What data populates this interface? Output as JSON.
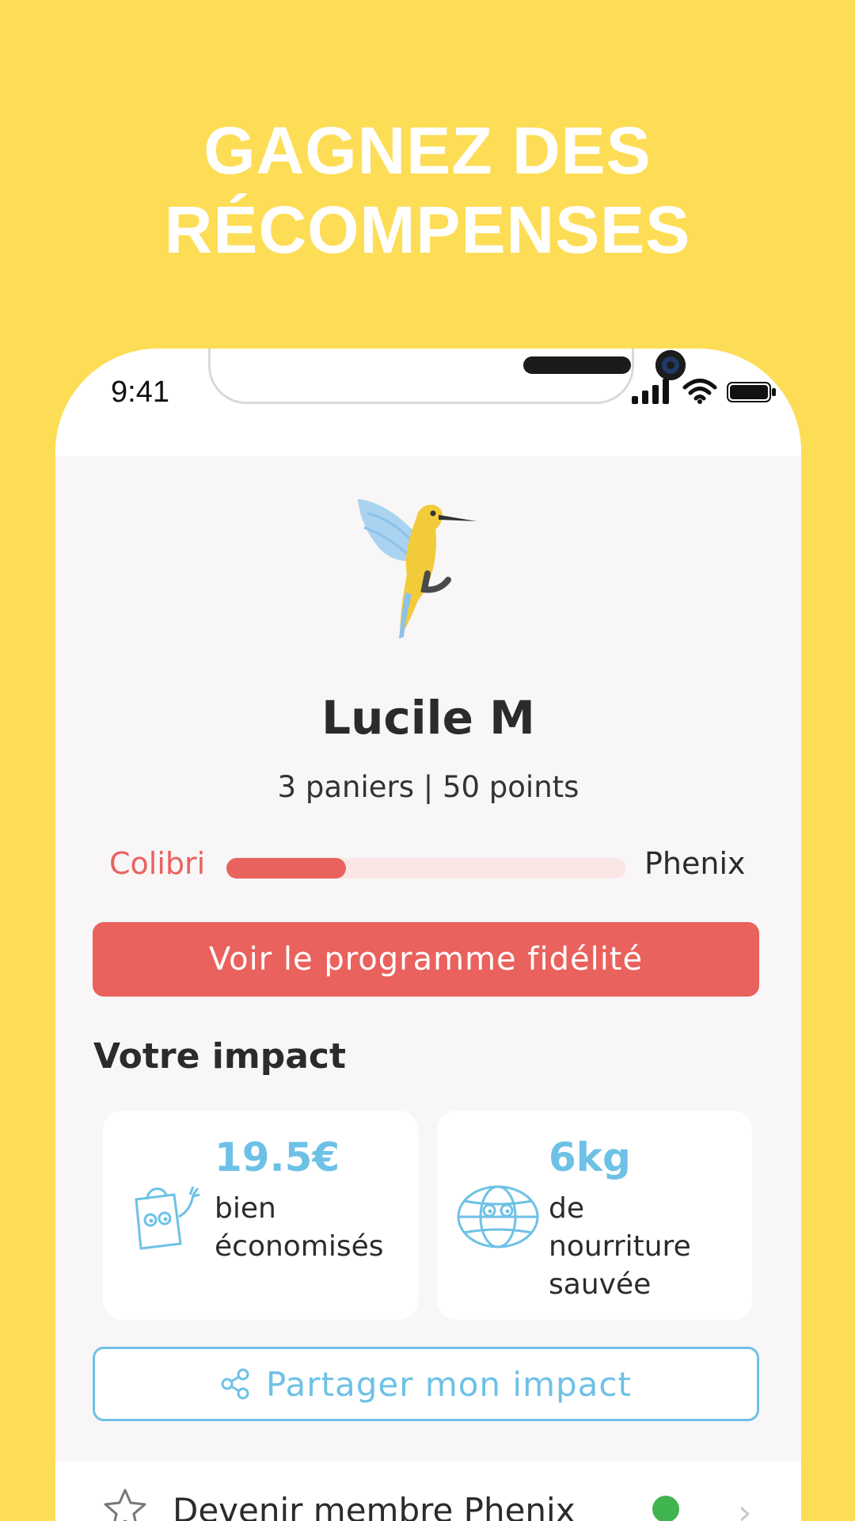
{
  "headline": {
    "line1": "GAGNEZ DES",
    "line2": "RÉCOMPENSES"
  },
  "status_bar": {
    "time": "9:41",
    "icons": [
      "signal-icon",
      "wifi-icon",
      "battery-icon"
    ]
  },
  "profile": {
    "avatar": "hummingbird-icon",
    "name": "Lucile M",
    "stats": "3 paniers | 50 points"
  },
  "level": {
    "current": "Colibri",
    "next": "Phenix",
    "progress_fraction": 0.3
  },
  "loyalty_button": {
    "label": "Voir le programme fidélité"
  },
  "impact": {
    "title": "Votre impact",
    "cards": [
      {
        "icon": "shopping-bag-icon",
        "value": "19.5€",
        "label_lines": [
          "bien",
          "économisés"
        ]
      },
      {
        "icon": "globe-icon",
        "value": "6kg",
        "label_lines": [
          "de",
          "nourriture",
          "sauvée"
        ]
      }
    ]
  },
  "share_button": {
    "icon": "share-icon",
    "label": "Partager mon impact"
  },
  "menu_row": {
    "icon": "star-icon",
    "label": "Devenir membre Phenix"
  },
  "colors": {
    "background": "#FEDD56",
    "accent_red": "#EA625D",
    "accent_blue": "#6EC1E6",
    "status_green": "#3FB44F"
  }
}
